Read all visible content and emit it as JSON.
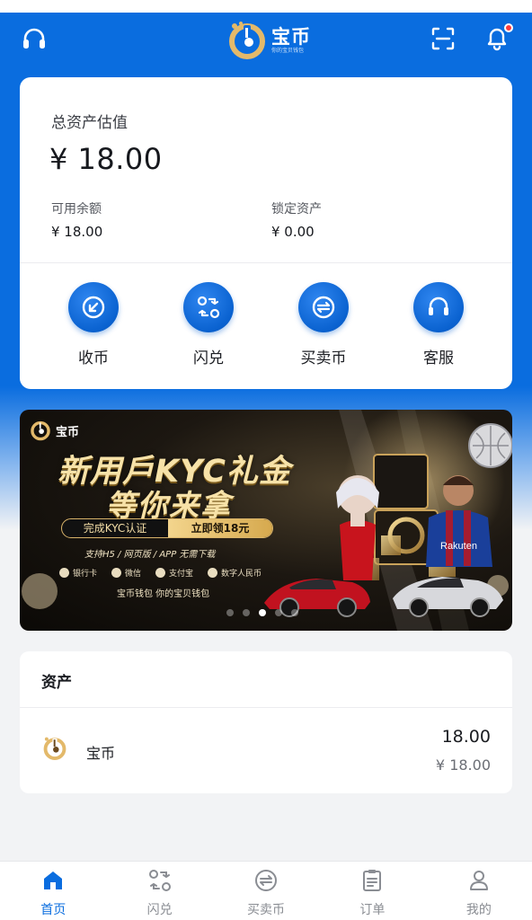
{
  "header": {
    "brand_title": "宝币",
    "brand_subtitle": "你的宝贝钱包",
    "icons": [
      "headset-icon",
      "scan-icon",
      "bell-icon"
    ],
    "has_notification": true
  },
  "asset_summary": {
    "total_label": "总资产估值",
    "total_value": "¥ 18.00",
    "available_label": "可用余额",
    "available_value": "¥ 18.00",
    "locked_label": "锁定资产",
    "locked_value": "¥ 0.00"
  },
  "actions": [
    {
      "label": "收币",
      "icon": "receive-icon"
    },
    {
      "label": "闪兑",
      "icon": "swap-icon"
    },
    {
      "label": "买卖币",
      "icon": "trade-icon"
    },
    {
      "label": "客服",
      "icon": "headset-icon"
    }
  ],
  "banner": {
    "brand": "宝币",
    "headline_line1": "新用戶KYC礼金",
    "headline_line2": "等你来拿",
    "kyc_left": "完成KYC认证",
    "kyc_right": "立即领18元",
    "support_text": "支持H5 / 网页版 / APP 无需下载",
    "payments": [
      "银行卡",
      "微信",
      "支付宝",
      "数字人民币"
    ],
    "tagline": "宝币钱包 你的宝贝钱包",
    "slide_count": 5,
    "active_slide": 2
  },
  "holdings": {
    "title": "资产",
    "items": [
      {
        "name": "宝币",
        "amount": "18.00",
        "value": "¥ 18.00",
        "icon": "baobi-coin-icon"
      }
    ]
  },
  "tabbar": {
    "tabs": [
      {
        "label": "首页",
        "icon": "home-icon",
        "active": true
      },
      {
        "label": "闪兑",
        "icon": "swap-icon",
        "active": false
      },
      {
        "label": "买卖币",
        "icon": "trade-icon",
        "active": false
      },
      {
        "label": "订单",
        "icon": "orders-icon",
        "active": false
      },
      {
        "label": "我的",
        "icon": "profile-icon",
        "active": false
      }
    ]
  },
  "colors": {
    "primary": "#0a6ddf",
    "accent_gold": "#d6a94e",
    "notification": "#ff3b3b"
  }
}
